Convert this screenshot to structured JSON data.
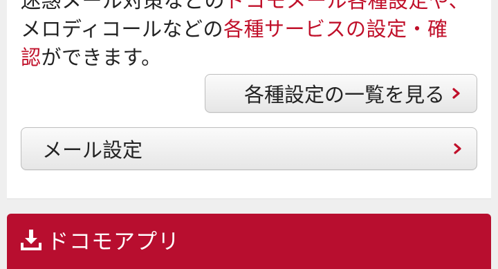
{
  "intro": {
    "line1_black": "迷惑メール対策などの",
    "line1_red": "ドコモメール各種設定や、",
    "line2_black": "メロディコールなどの",
    "line2_red": "各種サービスの設定・確",
    "line3_red": "認",
    "line3_black": "ができます。"
  },
  "buttons": {
    "settings_list_label": "各種設定の一覧を見る",
    "mail_settings_label": "メール設定"
  },
  "app_section": {
    "title": "ドコモアプリ"
  },
  "icons": {
    "chevron": "chevron-right-icon",
    "download": "download-icon"
  },
  "colors": {
    "accent_red": "#c0102a",
    "app_bar_red": "#b80e2f"
  }
}
